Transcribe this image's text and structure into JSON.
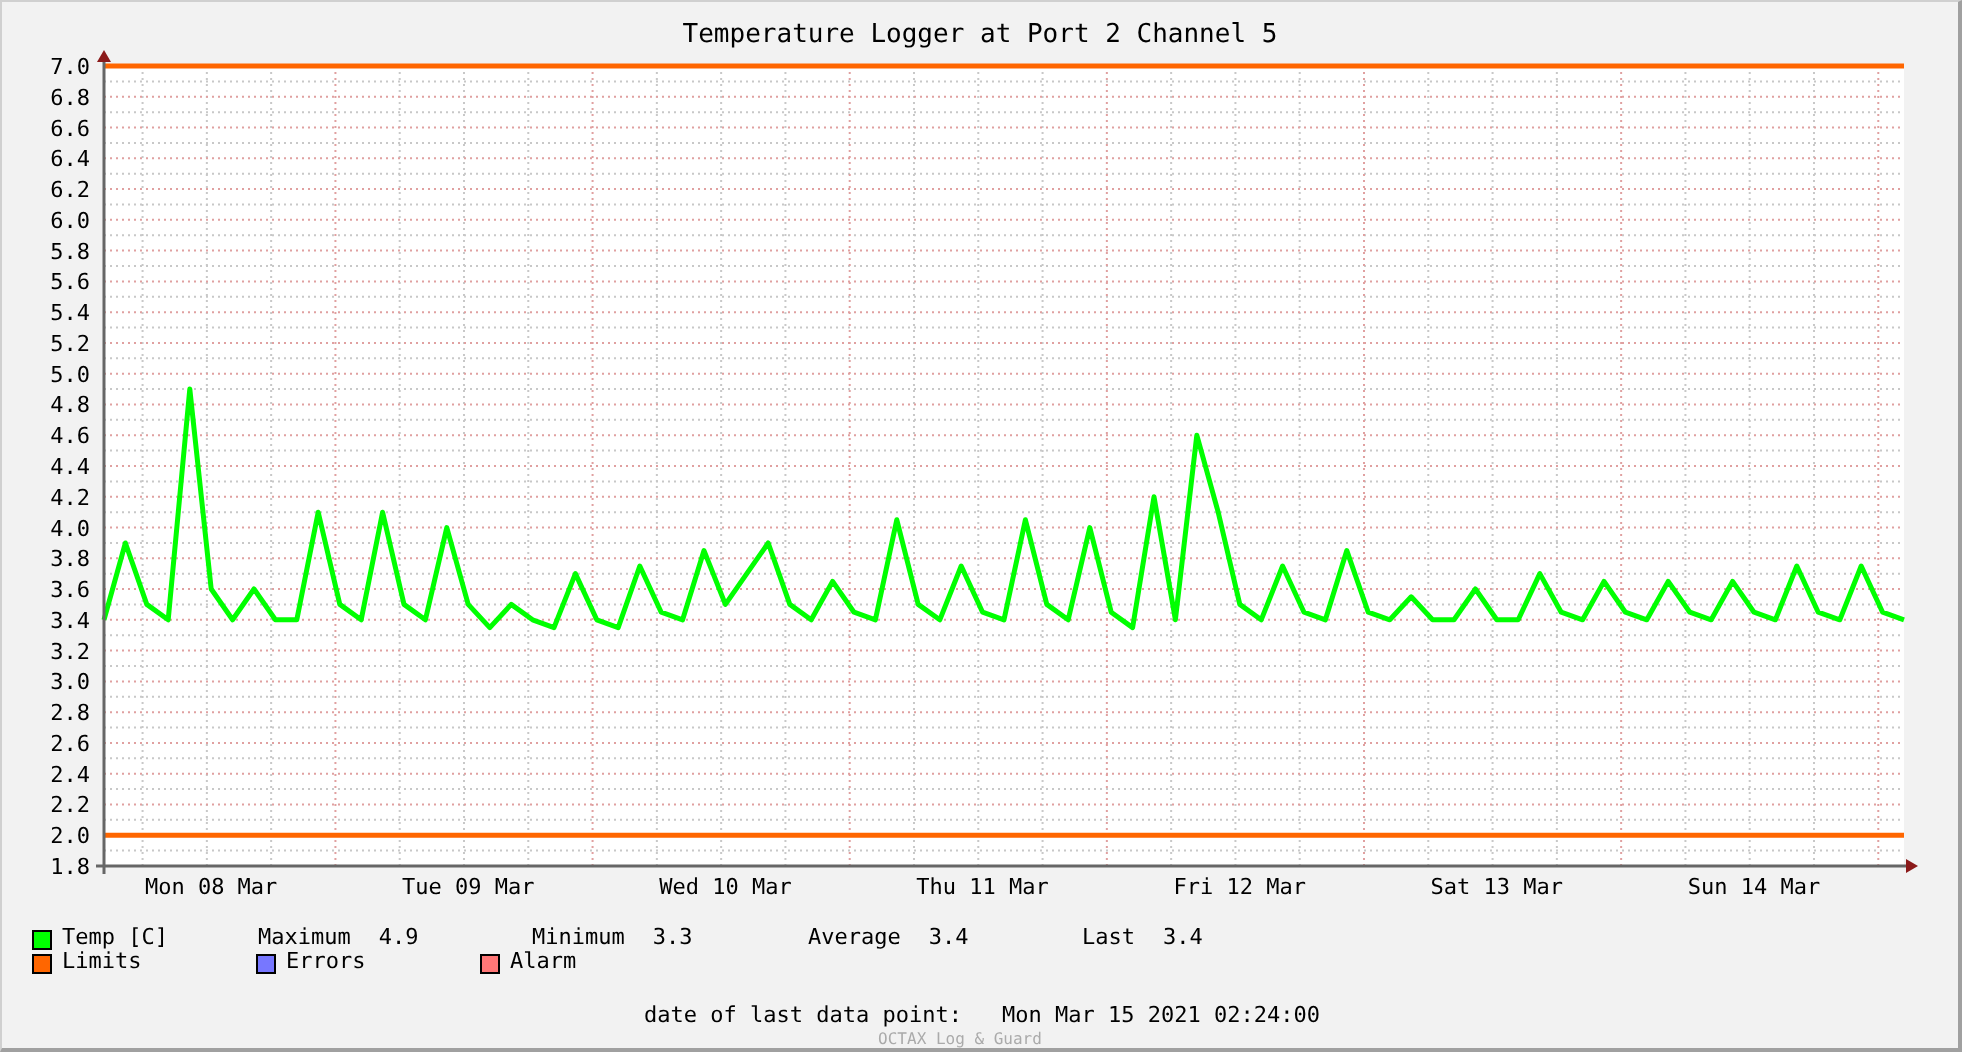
{
  "title": "Temperature Logger at Port 2 Channel 5",
  "chart": {
    "chart_data": {
      "type": "line",
      "categories": [
        null,
        null,
        null,
        null,
        null,
        "Mon 08 Mar",
        null,
        null,
        null,
        null,
        null,
        null,
        null,
        null,
        null,
        null,
        null,
        "Tue 09 Mar",
        null,
        null,
        null,
        null,
        null,
        null,
        null,
        null,
        null,
        null,
        null,
        "Wed 10 Mar",
        null,
        null,
        null,
        null,
        null,
        null,
        null,
        null,
        null,
        null,
        null,
        "Thu 11 Mar",
        null,
        null,
        null,
        null,
        null,
        null,
        null,
        null,
        null,
        null,
        null,
        "Fri 12 Mar",
        null,
        null,
        null,
        null,
        null,
        null,
        null,
        null,
        null,
        null,
        null,
        "Sat 13 Mar",
        null,
        null,
        null,
        null,
        null,
        null,
        null,
        null,
        null,
        null,
        null,
        "Sun 14 Mar",
        null,
        null,
        null,
        null,
        null,
        null,
        null
      ],
      "series": [
        {
          "name": "Temp [C]",
          "color": "#00ff00",
          "values": [
            3.4,
            3.9,
            3.5,
            3.4,
            4.9,
            3.6,
            3.4,
            3.6,
            3.4,
            3.4,
            4.1,
            3.5,
            3.4,
            4.1,
            3.5,
            3.4,
            4.0,
            3.5,
            3.35,
            3.5,
            3.4,
            3.35,
            3.7,
            3.4,
            3.35,
            3.75,
            3.45,
            3.4,
            3.85,
            3.5,
            3.7,
            3.9,
            3.5,
            3.4,
            3.65,
            3.45,
            3.4,
            4.05,
            3.5,
            3.4,
            3.75,
            3.45,
            3.4,
            4.05,
            3.5,
            3.4,
            4.0,
            3.45,
            3.35,
            4.2,
            3.4,
            4.6,
            4.1,
            3.5,
            3.4,
            3.75,
            3.45,
            3.4,
            3.85,
            3.45,
            3.4,
            3.55,
            3.4,
            3.4,
            3.6,
            3.4,
            3.4,
            3.7,
            3.45,
            3.4,
            3.65,
            3.45,
            3.4,
            3.65,
            3.45,
            3.4,
            3.65,
            3.45,
            3.4,
            3.75,
            3.45,
            3.4,
            3.75,
            3.45,
            3.4
          ]
        }
      ],
      "ylim": [
        1.8,
        7.0
      ],
      "yticks": [
        {
          "value": 1.8,
          "label": "1.8"
        },
        {
          "value": 2.0,
          "label": "2.0"
        },
        {
          "value": 2.2,
          "label": "2.2"
        },
        {
          "value": 2.4,
          "label": "2.4"
        },
        {
          "value": 2.6,
          "label": "2.6"
        },
        {
          "value": 2.8,
          "label": "2.8"
        },
        {
          "value": 3.0,
          "label": "3.0"
        },
        {
          "value": 3.2,
          "label": "3.2"
        },
        {
          "value": 3.4,
          "label": "3.4"
        },
        {
          "value": 3.6,
          "label": "3.6"
        },
        {
          "value": 3.8,
          "label": "3.8"
        },
        {
          "value": 4.0,
          "label": "4.0"
        },
        {
          "value": 4.2,
          "label": "4.2"
        },
        {
          "value": 4.4,
          "label": "4.4"
        },
        {
          "value": 4.6,
          "label": "4.6"
        },
        {
          "value": 4.8,
          "label": "4.8"
        },
        {
          "value": 5.0,
          "label": "5.0"
        },
        {
          "value": 5.2,
          "label": "5.2"
        },
        {
          "value": 5.4,
          "label": "5.4"
        },
        {
          "value": 5.6,
          "label": "5.6"
        },
        {
          "value": 5.8,
          "label": "5.8"
        },
        {
          "value": 6.0,
          "label": "6.0"
        },
        {
          "value": 6.2,
          "label": "6.2"
        },
        {
          "value": 6.4,
          "label": "6.4"
        },
        {
          "value": 6.6,
          "label": "6.6"
        },
        {
          "value": 6.8,
          "label": "6.8"
        },
        {
          "value": 7.0,
          "label": "7.0"
        }
      ],
      "grid": true,
      "ref_lines": [
        {
          "axis": "y",
          "value": 7.0,
          "color": "#ff6600"
        },
        {
          "axis": "y",
          "value": 2.0,
          "color": "#ff6600"
        }
      ]
    }
  },
  "legend": {
    "stats": [
      {
        "label": "Maximum",
        "value": "4.9"
      },
      {
        "label": "Minimum",
        "value": "3.3"
      },
      {
        "label": "Average",
        "value": "3.4"
      },
      {
        "label": "Last",
        "value": "3.4"
      }
    ],
    "others": [
      {
        "label": "Limits",
        "color": "#ff6600"
      },
      {
        "label": "Errors",
        "color": "#7777ff"
      },
      {
        "label": "Alarm",
        "color": "#ff7777"
      }
    ]
  },
  "footer": {
    "label": "date of last data point:",
    "value": "Mon Mar 15 2021 02:24:00"
  },
  "credit": "OCTAX Log & Guard"
}
